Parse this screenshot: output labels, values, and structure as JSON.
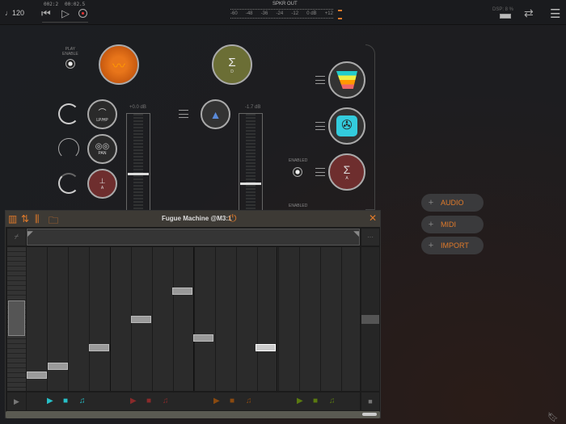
{
  "transport": {
    "tempo": "♩120",
    "position_bars": "002:2",
    "position_time": "00:02.5"
  },
  "meter": {
    "title": "SPKR OUT",
    "ticks": [
      "-60",
      "-48",
      "-36",
      "-24",
      "-12",
      "0 dB",
      "+12"
    ]
  },
  "status": {
    "dsp": "DSP: 8 %"
  },
  "mixer": {
    "play_enable": "PLAY\nENABLE",
    "lpfhp": "LP/HP",
    "pan": "PAN",
    "send_a": "A",
    "bus_d": "D",
    "fader1_db": "+0.0 dB",
    "fader2_db": "-1.7 dB",
    "fader1_level": 0.62,
    "fader2_level": 0.72,
    "enabled1": "ENABLED",
    "enabled2": "ENABLED",
    "bus_a": "A"
  },
  "add_menu": {
    "audio": "AUDIO",
    "midi": "MIDI",
    "import": "IMPORT"
  },
  "plugin": {
    "title": "Fugue Machine @M3:1",
    "more": "···",
    "notes": [
      {
        "step": 0,
        "pitch": 1
      },
      {
        "step": 1,
        "pitch": 2
      },
      {
        "step": 3,
        "pitch": 4
      },
      {
        "step": 5,
        "pitch": 7
      },
      {
        "step": 7,
        "pitch": 10
      },
      {
        "step": 8,
        "pitch": 5
      },
      {
        "step": 11,
        "pitch": 4,
        "selected": true
      }
    ],
    "players": [
      {
        "color": "#27c0c8"
      },
      {
        "color": "#8a2a2a"
      },
      {
        "color": "#8a4a10"
      },
      {
        "color": "#5a7a10"
      }
    ]
  },
  "colors": {
    "accent": "#e07a2a",
    "background": "#1c1e22"
  }
}
